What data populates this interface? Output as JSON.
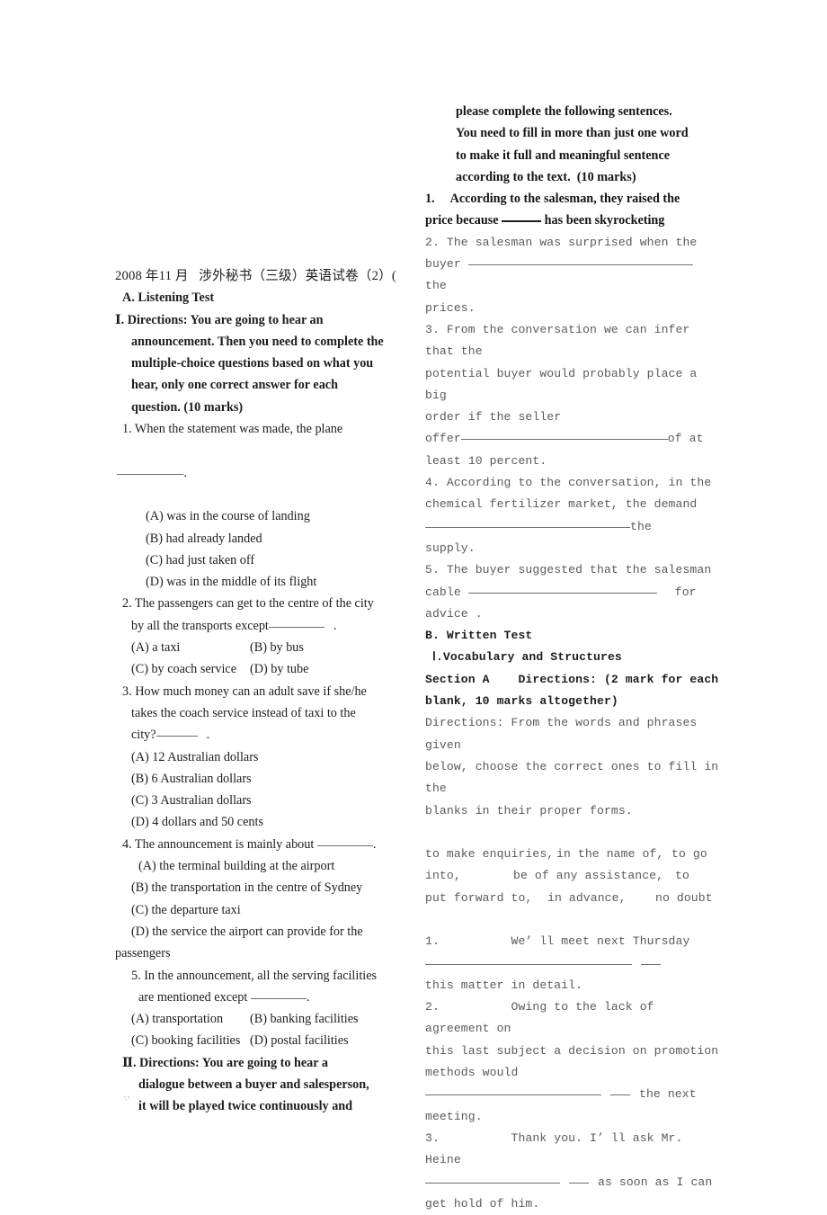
{
  "document": {
    "title_line": "2008 年11 月   涉外秘书（三级）英语试卷（2）(",
    "section_a_heading": "A. Listening Test"
  },
  "left_column": {
    "part_one": {
      "marker": "Ⅰ",
      "directions_lines": [
        "Ⅰ. Directions: You are going to hear an",
        "announcement. Then you need to complete the",
        "multiple-choice questions based on what you",
        "hear, only one correct answer for each",
        "question. (10 marks)"
      ],
      "questions": [
        {
          "number": "1.",
          "stem_lines": [
            "1. When the statement was made, the plane"
          ],
          "blank_tail": ".",
          "options": [
            "(A) was in the course of landing",
            "(B) had already landed",
            "(C) had just taken off",
            "(D) was in the middle of its flight"
          ]
        },
        {
          "number": "2.",
          "stem_lines": [
            "2. The passengers can get to the centre of the city",
            "by all the transports except"
          ],
          "blank_tail": ".",
          "option_pairs": [
            {
              "left": "(A) a taxi",
              "right": "(B) by bus"
            },
            {
              "left": "(C) by coach service",
              "right": "(D) by tube"
            }
          ]
        },
        {
          "number": "3.",
          "stem_lines": [
            "3. How much money can an adult save if she/he",
            "takes the coach service instead of taxi to the",
            "city?"
          ],
          "blank_tail": ".",
          "options": [
            "(A) 12 Australian dollars",
            "(B) 6 Australian dollars",
            "(C) 3 Australian dollars",
            "(D) 4 dollars and 50 cents"
          ]
        },
        {
          "number": "4.",
          "stem_prefix": "4. The announcement is mainly about ",
          "blank_tail": ".",
          "options": [
            "(A) the terminal building at the airport",
            "(B) the transportation in the centre of Sydney",
            "(C) the departure taxi",
            "(D) the service the airport can provide for the"
          ],
          "option_d_wrap": "passengers"
        },
        {
          "number": "5.",
          "stem_lines": [
            "5. In the announcement, all the serving facilities",
            "are mentioned except "
          ],
          "blank_tail": ".",
          "option_pairs": [
            {
              "left": "(A) transportation",
              "right": "(B) banking facilities"
            },
            {
              "left": "(C) booking facilities",
              "right": "(D) postal facilities"
            }
          ]
        }
      ]
    },
    "part_two": {
      "marker": "Ⅱ",
      "directions_lines": [
        "Ⅱ. Directions: You are going to hear a",
        "dialogue between a buyer and salesperson,",
        "it will be played twice continuously and"
      ]
    }
  },
  "right_column": {
    "directions_continued": [
      "please complete the following sentences.",
      "You need to fill in more than just one word",
      "to make it full and meaningful sentence",
      "according to the text.  (10 marks)"
    ],
    "items": [
      {
        "number": "1.",
        "bold": true,
        "line1": "1.     According to the salesman, they raised the",
        "line2_prefix": "price because ",
        "line2_suffix": " has been skyrocketing"
      },
      {
        "number": "2.",
        "bold": false,
        "line1": "2. The salesman was surprised when the",
        "line2_prefix": "buyer ",
        "line2_suffix": "the",
        "line3": "prices."
      },
      {
        "number": "3.",
        "bold": false,
        "line1": "3. From the conversation we can infer that the",
        "line2": "potential buyer would probably place a big",
        "line3": "order if the seller",
        "line4_prefix": "offer",
        "line4_suffix": "of at",
        "line5": "least 10 percent."
      },
      {
        "number": "4.",
        "bold": false,
        "line1": "4. According to the conversation, in the",
        "line2": "chemical fertilizer market, the demand",
        "line3_suffix": "the",
        "line4": "supply."
      },
      {
        "number": "5.",
        "bold": false,
        "line1": "5. The buyer suggested that the salesman",
        "line2_prefix": "cable ",
        "line2_suffix": "for",
        "line3": "advice ."
      }
    ],
    "written_test": {
      "heading": "B. Written Test",
      "subheading": "Ⅰ.Vocabulary and Structures",
      "section_line": "Section A    Directions: (2 mark for each",
      "section_line2": "blank, 10 marks altogether)",
      "directions_lines": [
        "Directions: From the words and phrases given",
        "below, choose the correct ones to fill in the",
        "blanks in their proper forms."
      ],
      "word_bank_rows": [
        [
          "to make enquiries,",
          "in the name of,",
          "to go"
        ],
        [
          "into,",
          "be of any assistance,",
          "to"
        ],
        [
          "put forward to,",
          "in advance,",
          "no doubt"
        ]
      ],
      "exercises": [
        {
          "number": "1.",
          "line1": "1.          We’ ll meet next Thursday",
          "line3": "this matter in detail."
        },
        {
          "number": "2.",
          "line1": "2.          Owing to the lack of agreement on",
          "line2": "this last subject a decision on promotion",
          "line3": "methods would",
          "line4_suffix": "the next",
          "line5": "meeting."
        },
        {
          "number": "3.",
          "line1": "3.          Thank you. I’ ll ask Mr. Heine",
          "line2_suffix": "as soon as I can",
          "line3": "get hold of him."
        }
      ]
    }
  }
}
